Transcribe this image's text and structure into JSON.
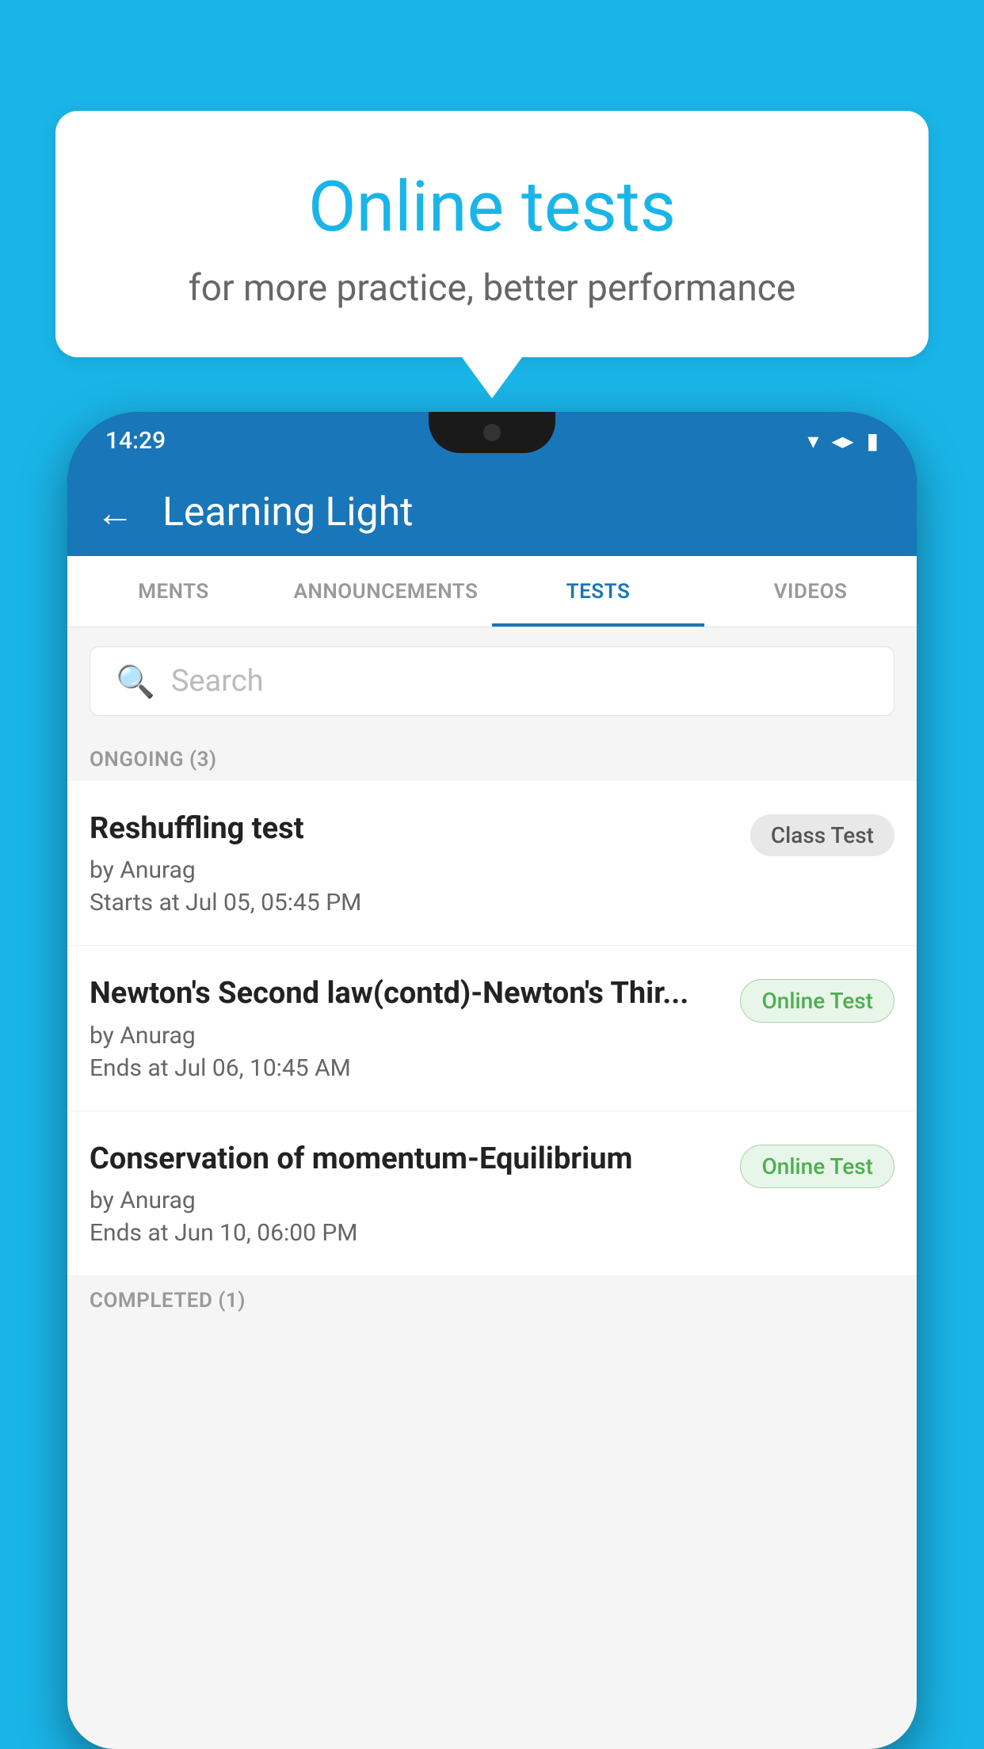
{
  "background_color": "#1ab5e8",
  "bubble": {
    "title": "Online tests",
    "subtitle": "for more practice, better performance"
  },
  "phone": {
    "status_bar": {
      "time": "14:29"
    },
    "header": {
      "title": "Learning Light",
      "back_label": "←"
    },
    "tabs": [
      {
        "label": "MENTS",
        "active": false
      },
      {
        "label": "ANNOUNCEMENTS",
        "active": false
      },
      {
        "label": "TESTS",
        "active": true
      },
      {
        "label": "VIDEOS",
        "active": false
      }
    ],
    "search": {
      "placeholder": "Search"
    },
    "ongoing_section": {
      "label": "ONGOING (3)"
    },
    "tests": [
      {
        "name": "Reshuffling test",
        "author": "by Anurag",
        "time_label": "Starts at",
        "time": "Jul 05, 05:45 PM",
        "badge": "Class Test",
        "badge_type": "class"
      },
      {
        "name": "Newton's Second law(contd)-Newton's Thir...",
        "author": "by Anurag",
        "time_label": "Ends at",
        "time": "Jul 06, 10:45 AM",
        "badge": "Online Test",
        "badge_type": "online"
      },
      {
        "name": "Conservation of momentum-Equilibrium",
        "author": "by Anurag",
        "time_label": "Ends at",
        "time": "Jun 10, 06:00 PM",
        "badge": "Online Test",
        "badge_type": "online"
      }
    ],
    "completed_section": {
      "label": "COMPLETED (1)"
    }
  }
}
